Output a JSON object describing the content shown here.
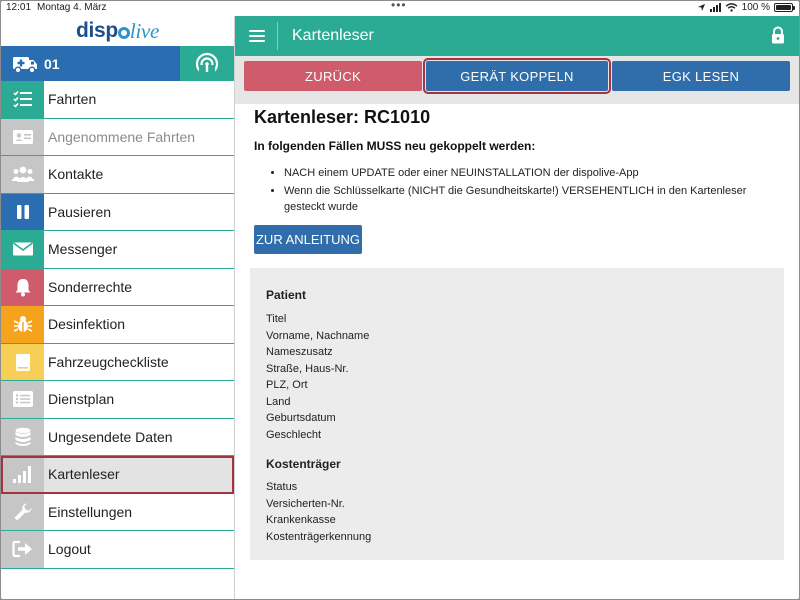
{
  "status_bar": {
    "time": "12:01",
    "date": "Montag 4. März",
    "battery": "100 %",
    "battery_level": 1.0
  },
  "sidebar": {
    "logo_left": "disp",
    "logo_right": "live",
    "vehicle_number": "01",
    "items": [
      {
        "label": "Fahrten",
        "icon": "list-check-icon",
        "color": "#2bab94",
        "disabled": false,
        "active": false
      },
      {
        "label": "Angenommene Fahrten",
        "icon": "id-card-icon",
        "color": "#c6c6c6",
        "disabled": true,
        "active": false
      },
      {
        "label": "Kontakte",
        "icon": "people-icon",
        "color": "#c6c6c6",
        "disabled": false,
        "active": false
      },
      {
        "label": "Pausieren",
        "icon": "pause-icon",
        "color": "#2a6db1",
        "disabled": false,
        "active": false
      },
      {
        "label": "Messenger",
        "icon": "envelope-icon",
        "color": "#2bab94",
        "disabled": false,
        "active": false
      },
      {
        "label": "Sonderrechte",
        "icon": "bell-icon",
        "color": "#d05b6a",
        "disabled": false,
        "active": false
      },
      {
        "label": "Desinfektion",
        "icon": "bug-icon",
        "color": "#f5a31c",
        "disabled": false,
        "active": false
      },
      {
        "label": "Fahrzeugcheckliste",
        "icon": "clipboard-icon",
        "color": "#f7cf57",
        "disabled": false,
        "active": false
      },
      {
        "label": "Dienstplan",
        "icon": "schedule-list-icon",
        "color": "#c6c6c6",
        "disabled": false,
        "active": false
      },
      {
        "label": "Ungesendete Daten",
        "icon": "database-icon",
        "color": "#c6c6c6",
        "disabled": false,
        "active": false
      },
      {
        "label": "Kartenleser",
        "icon": "signal-bars-icon",
        "color": "#c6c6c6",
        "disabled": false,
        "active": true
      },
      {
        "label": "Einstellungen",
        "icon": "wrench-icon",
        "color": "#c6c6c6",
        "disabled": false,
        "active": false
      },
      {
        "label": "Logout",
        "icon": "logout-icon",
        "color": "#c6c6c6",
        "disabled": false,
        "active": false
      }
    ]
  },
  "header": {
    "title": "Kartenleser"
  },
  "toolbar": {
    "back_label": "ZURÜCK",
    "pair_label": "GERÄT KOPPELN",
    "egk_label": "EGK LESEN"
  },
  "content": {
    "title": "Kartenleser: RC1010",
    "subtitle": "In folgenden Fällen MUSS neu gekoppelt werden:",
    "bullets": [
      "NACH einem UPDATE oder einer NEUINSTALLATION der dispolive-App",
      "Wenn die Schlüsselkarte (NICHT die Gesundheitskarte!) VERSEHENTLICH in den Kartenleser gesteckt wurde"
    ],
    "guide_button": "ZUR ANLEITUNG",
    "patient_heading": "Patient",
    "patient_fields": [
      "Titel",
      "Vorname, Nachname",
      "Nameszusatz",
      "Straße, Haus-Nr.",
      "PLZ, Ort",
      "Land",
      "Geburtsdatum",
      "Geschlecht"
    ],
    "insurer_heading": "Kostenträger",
    "insurer_fields": [
      "Status",
      "Versicherten-Nr.",
      "Krankenkasse",
      "Kostenträgerkennung"
    ]
  },
  "colors": {
    "accent_teal": "#2bab94",
    "accent_blue": "#2f6eaa",
    "accent_red": "#d05b6a",
    "highlight_outline": "#a8323e"
  }
}
